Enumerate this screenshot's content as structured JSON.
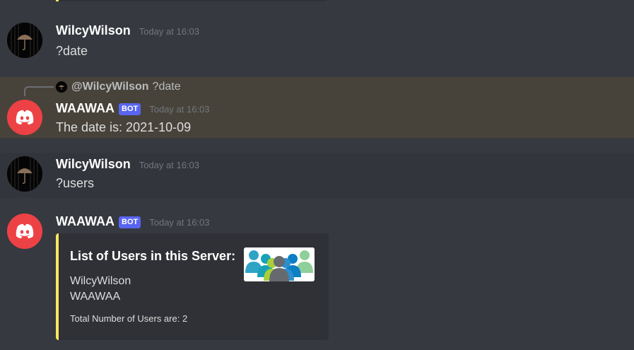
{
  "messages": [
    {
      "username": "WilcyWilson",
      "timestamp": "Today at 16:03",
      "content": "?date"
    },
    {
      "reply": {
        "username": "@WilcyWilson",
        "content": "?date"
      },
      "username": "WAAWAA",
      "bot_tag": "BOT",
      "timestamp": "Today at 16:03",
      "content": "The date is: 2021-10-09"
    },
    {
      "username": "WilcyWilson",
      "timestamp": "Today at 16:03",
      "content": "?users"
    },
    {
      "username": "WAAWAA",
      "bot_tag": "BOT",
      "timestamp": "Today at 16:03",
      "embed": {
        "title": "List of Users in this Server:",
        "lines": [
          "WilcyWilson",
          "WAAWAA"
        ],
        "footer": "Total Number of Users are: 2",
        "thumbnail_icon": "users-group-icon",
        "accent_color": "#fee75c"
      }
    }
  ],
  "colors": {
    "background": "#36393f",
    "highlight": "#48433a",
    "bot_tag": "#5865f2",
    "discord_red": "#ed4245",
    "embed_bg": "#2f3136",
    "embed_accent": "#fee75c"
  },
  "icons": {
    "user_avatar": "umbrella-avatar-icon",
    "bot_avatar": "discord-logo-icon"
  }
}
